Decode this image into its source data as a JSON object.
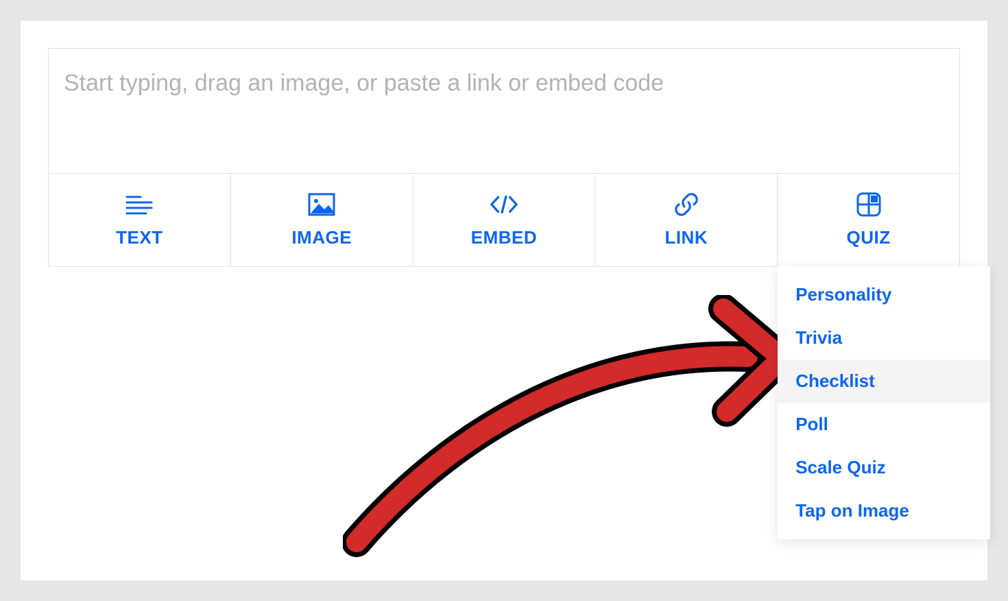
{
  "editor": {
    "placeholder": "Start typing, drag an image, or paste a link or embed code"
  },
  "tabs": {
    "text": {
      "label": "TEXT"
    },
    "image": {
      "label": "IMAGE"
    },
    "embed": {
      "label": "EMBED"
    },
    "link": {
      "label": "LINK"
    },
    "quiz": {
      "label": "QUIZ"
    }
  },
  "quiz_menu": {
    "items": [
      {
        "label": "Personality",
        "highlight": false
      },
      {
        "label": "Trivia",
        "highlight": false
      },
      {
        "label": "Checklist",
        "highlight": true
      },
      {
        "label": "Poll",
        "highlight": false
      },
      {
        "label": "Scale Quiz",
        "highlight": false
      },
      {
        "label": "Tap on Image",
        "highlight": false
      }
    ]
  },
  "colors": {
    "accent": "#0f65ef",
    "arrow": "#d32a2a"
  }
}
